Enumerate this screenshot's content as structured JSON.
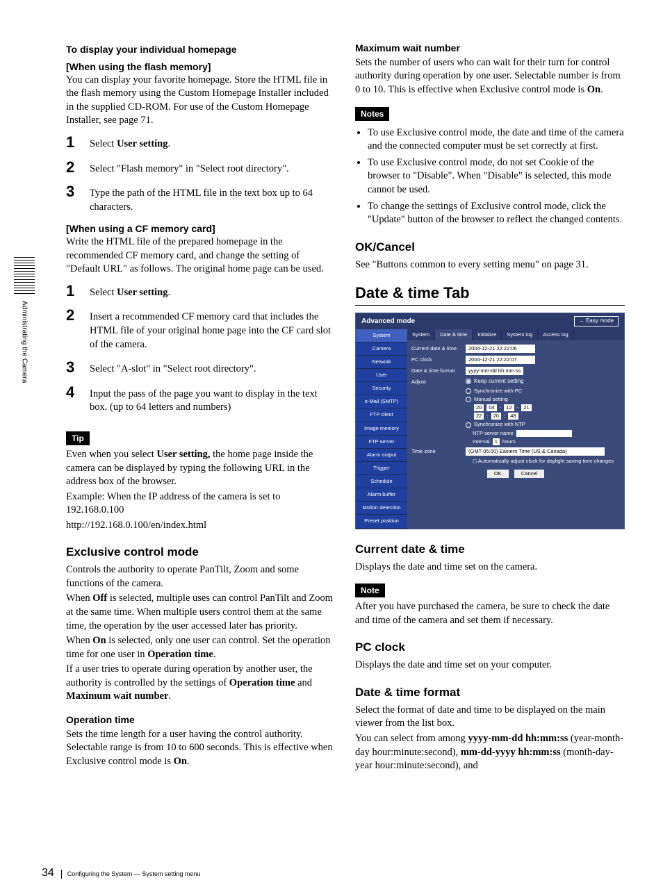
{
  "side_tab": "Administrating the Camera",
  "page_number": "34",
  "footer_text": "Configuring the System — System setting menu",
  "col1": {
    "h1a": "To display your individual homepage",
    "h1b": "[When using the flash memory]",
    "p1": "You can display your favorite homepage. Store the HTML file in the flash memory using the Custom Homepage Installer included in the supplied CD-ROM. For use of the Custom Homepage Installer, see page 71.",
    "steps1": [
      {
        "n": "1",
        "t_pre": "Select ",
        "t_b": "User setting",
        "t_post": "."
      },
      {
        "n": "2",
        "t": "Select \"Flash memory\" in \"Select root directory\"."
      },
      {
        "n": "3",
        "t": "Type the path of the HTML file in the text box up to 64 characters."
      }
    ],
    "h2": "[When using a CF memory card]",
    "p2": "Write the HTML file of the prepared homepage in the recommended CF memory card, and change the setting of \"Default URL\" as follows. The original home page can be used.",
    "steps2": [
      {
        "n": "1",
        "t_pre": "Select ",
        "t_b": "User setting",
        "t_post": "."
      },
      {
        "n": "2",
        "t": "Insert a recommended CF memory card that includes the HTML file of your original home page into the CF card slot of the camera."
      },
      {
        "n": "3",
        "t": "Select \"A-slot\" in \"Select root directory\"."
      },
      {
        "n": "4",
        "t": "Input the pass of the page you want to display in the text box. (up to 64 letters and numbers)"
      }
    ],
    "tip_label": "Tip",
    "tip_p1a": "Even when you select ",
    "tip_p1b": "User setting,",
    "tip_p1c": " the home page inside the camera can be displayed by typing the following URL in the address box of the browser.",
    "tip_p2": "Example: When the IP address of the camera is set to 192.168.0.100",
    "tip_p3": "http://192.168.0.100/en/index.html",
    "exc_h": "Exclusive control mode",
    "exc_p1": "Controls the authority to operate PanTilt, Zoom and some functions of the camera.",
    "exc_p2a": "When ",
    "exc_p2b": "Off",
    "exc_p2c": " is selected, multiple uses can control PanTilt and Zoom at the same time. When multiple users control them at the same time, the operation by the user accessed later has priority.",
    "exc_p3a": "When ",
    "exc_p3b": "On",
    "exc_p3c": " is selected, only one user can control. Set the operation time for one user in ",
    "exc_p3d": "Operation time",
    "exc_p3e": ".",
    "exc_p4a": "If a user tries to operate during operation by another user, the authority is controlled by the settings of ",
    "exc_p4b": "Operation time",
    "exc_p4c": " and ",
    "exc_p4d": "Maximum wait number",
    "exc_p4e": ".",
    "opt_h": "Operation time",
    "opt_p1a": "Sets the time length for a user having the control authority. Selectable range is from 10 to 600 seconds. This is effective when Exclusive control mode is ",
    "opt_p1b": "On",
    "opt_p1c": "."
  },
  "col2": {
    "max_h": "Maximum wait number",
    "max_p1a": "Sets the number of users who can wait for their turn for control authority during operation by one user. Selectable number is from 0 to 10. This is effective when Exclusive control mode is ",
    "max_p1b": "On",
    "max_p1c": ".",
    "notes_label": "Notes",
    "notes": [
      "To use Exclusive control mode, the date and time of the camera and the connected computer must be set correctly at first.",
      "To use Exclusive control mode, do not set Cookie of the browser to \"Disable\". When \"Disable\" is selected, this mode cannot be used.",
      "To change the settings of Exclusive control mode, click the \"Update\" button of the browser to reflect the changed contents."
    ],
    "okc_h": "OK/Cancel",
    "okc_p": "See \"Buttons common to every setting menu\" on page 31.",
    "tab_h": "Date & time Tab",
    "shot": {
      "title": "Advanced mode",
      "easy": "→ Easy mode",
      "side": [
        "System",
        "Camera",
        "Network",
        "User",
        "Security",
        "e-Mail (SMTP)",
        "FTP client",
        "Image memory",
        "FTP server",
        "Alarm output",
        "Trigger",
        "Schedule",
        "Alarm buffer",
        "Motion detection",
        "Preset position"
      ],
      "tabs": [
        "System",
        "Date & time",
        "Initialize",
        "System log",
        "Access log"
      ],
      "rows": {
        "cur_l": "Current date & time",
        "cur_v": "2004-12-21  22:22:06",
        "pc_l": "PC clock",
        "pc_v": "2004-12-21  22:22:07",
        "fmt_l": "Date & time format",
        "fmt_v": "yyyy-mm-dd hh:mm:ss",
        "adj_l": "Adjust",
        "opt1": "Keep current setting",
        "opt2": "Synchronize with PC",
        "opt3": "Manual setting",
        "man_vals": [
          "20",
          "04",
          "12",
          "21"
        ],
        "man_vals2": [
          "22",
          "20",
          "48"
        ],
        "opt4": "Synchronize with NTP",
        "ntp": "NTP server name",
        "int_l": "Interval",
        "int_v": "1",
        "int_u": "hours",
        "tz_l": "Time zone",
        "tz_v": "(GMT-05:00) Eastern Time (US & Canada)",
        "dst": "Automatically adjust clock for daylight saving time changes"
      },
      "ok": "OK",
      "cancel": "Cancel"
    },
    "cur_h": "Current date & time",
    "cur_p": "Displays the date and time set on the camera.",
    "note_label": "Note",
    "note_p": "After you have purchased the camera, be sure to check the date and time of the camera and set them if necessary.",
    "pc_h": "PC clock",
    "pc_p": "Displays the date and time set on your computer.",
    "fmt_h": "Date & time format",
    "fmt_p1": "Select the format of date and time to be displayed on the main viewer from the list box.",
    "fmt_p2a": "You can select from among ",
    "fmt_p2b": "yyyy-mm-dd hh:mm:ss",
    "fmt_p2c": " (year-month-day hour:minute:second), ",
    "fmt_p2d": "mm-dd-yyyy hh:mm:ss",
    "fmt_p2e": " (month-day-year hour:minute:second), and"
  }
}
